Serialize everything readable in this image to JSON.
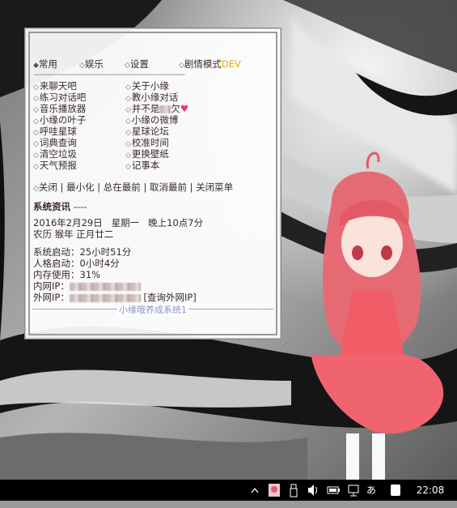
{
  "widget": {
    "tabs": [
      {
        "label": "常用"
      },
      {
        "label": "娱乐"
      },
      {
        "label": "设置"
      },
      {
        "label": "剧情模式",
        "suffix": "DEV"
      }
    ],
    "divider": "------------------------------------------------------------",
    "menu_left": [
      "来聊天吧",
      "练习对话吧",
      "音乐播放器",
      "小缘の叶子",
      "呼哇星球",
      "词典查询",
      "清空垃圾",
      "天气预报"
    ],
    "menu_right": [
      "关于小缘",
      "教小缘对话",
      "并不是",
      "小缘の微博",
      "星球论坛",
      "校准时间",
      "更换壁纸",
      "记事本"
    ],
    "menu_right_suffix": "欠",
    "heart": "♥",
    "actions": [
      "关闭",
      "最小化",
      "总在最前",
      "取消最前",
      "关闭菜单"
    ],
    "action_separator": "|",
    "action_prefix_icon": "diamond-bullet",
    "system_info": {
      "title": "系统资讯",
      "title_dashes": "----",
      "date": "2016年2月29日",
      "weekday": "星期一",
      "time_text": "晚上10点7分",
      "lunar": "农历 猴年 正月廿二",
      "uptime_label": "系统启动：",
      "uptime_value": "25小时51分",
      "persona_label": "人格启动：",
      "persona_value": "0小时4分",
      "memory_label": "内存使用：",
      "memory_value": "31%",
      "lan_ip_label": "内网IP：",
      "wan_ip_label": "外网IP：",
      "wan_ip_link": "[查询外网IP]"
    },
    "footer": "小缘哦养成系统1"
  },
  "taskbar": {
    "clock": "22:08",
    "ime": "あ",
    "icons": [
      "chevron-up-icon",
      "app-avatar-icon",
      "usb-icon",
      "speaker-icon",
      "battery-icon",
      "network-icon",
      "ime-icon",
      "night-mode-icon"
    ]
  },
  "colors": {
    "text": "#3a2a2a",
    "accent_dev": "#e8b000",
    "heart": "#e83a6a",
    "footer": "#8a93c8",
    "taskbar": "#000000"
  }
}
